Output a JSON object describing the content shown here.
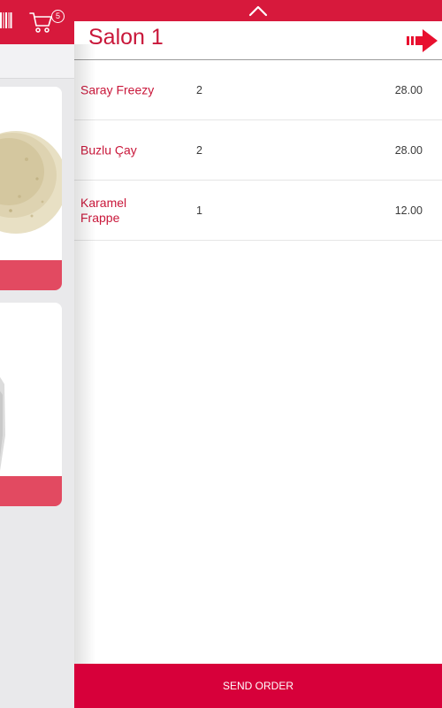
{
  "background": {
    "cart_badge_count": "5",
    "icons": [
      "barcode-icon",
      "cart-icon"
    ]
  },
  "order_panel": {
    "title": "Salon 1",
    "items": [
      {
        "name": "Saray Freezy",
        "quantity": "2",
        "price": "28.00"
      },
      {
        "name": "Buzlu Çay",
        "quantity": "2",
        "price": "28.00"
      },
      {
        "name": "Karamel Frappe",
        "quantity": "1",
        "price": "12.00"
      }
    ],
    "send_order_label": "SEND ORDER",
    "icons": [
      "chevron-up-icon",
      "arrow-right-icon"
    ]
  },
  "colors": {
    "brand_red": "#d7193c",
    "title_red": "#c9173a",
    "button_red": "#d7003a",
    "card_footer_pink": "#e24a61",
    "background_gray": "#e9e9eb"
  }
}
